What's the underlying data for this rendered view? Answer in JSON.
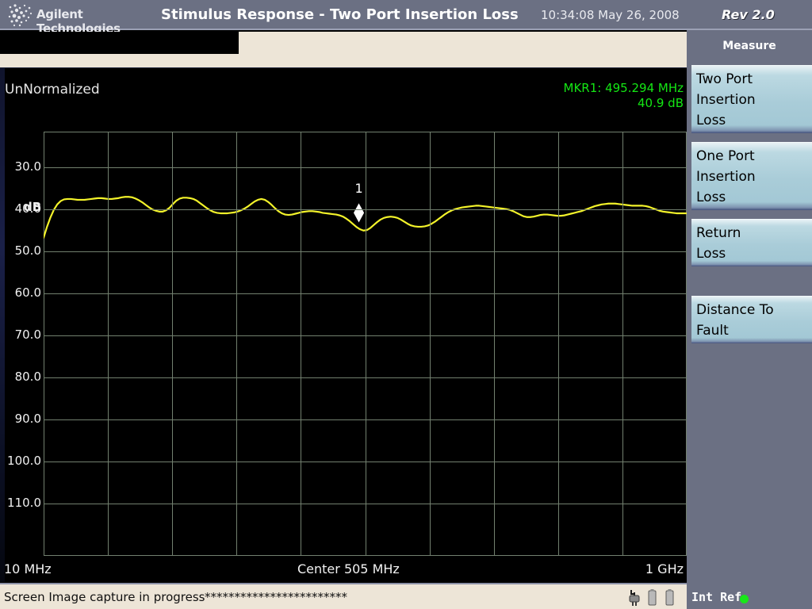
{
  "titlebar": {
    "brand": "Agilent Technologies",
    "brand_icon": "agilent-spark-logo",
    "title": "Stimulus Response - Two Port Insertion Loss",
    "clock": "10:34:08  May 26, 2008",
    "revision": "Rev 2.0"
  },
  "display": {
    "normalization_state": "UnNormalized",
    "marker_readout_line1": "MKR1: 495.294 MHz",
    "marker_readout_line2": "40.9 dB",
    "marker_color": "#14e614",
    "trace_color": "#f3f32a",
    "grid_color": "#72806f",
    "background_color": "#000000"
  },
  "softkeys": {
    "menu_title": "Measure",
    "items": [
      {
        "lines": [
          "Two Port",
          "Insertion",
          "Loss"
        ],
        "selected": true
      },
      {
        "lines": [
          "One Port",
          "Insertion",
          "Loss"
        ],
        "selected": false
      },
      {
        "lines": [
          "Return",
          "Loss"
        ],
        "selected": false
      },
      {
        "lines": [
          "Distance To",
          "Fault"
        ],
        "selected": false
      }
    ]
  },
  "statusbar": {
    "message": "Screen Image capture in progress",
    "progress_stars": "************************",
    "icons": [
      "power-plug-icon",
      "battery-icon",
      "battery-icon"
    ],
    "reference_label": "Int Ref",
    "reference_led_color": "#19e619"
  },
  "chart_data": {
    "type": "line",
    "title": "Two Port Insertion Loss",
    "xlabel": "",
    "ylabel": "dB",
    "x_start_label": "10 MHz",
    "x_center_label": "Center 505 MHz",
    "x_stop_label": "1 GHz",
    "xlim_mhz": [
      10,
      1000
    ],
    "x_divisions": 10,
    "ylim_db": [
      21.6,
      122.4
    ],
    "y_tick_labels": [
      "30.0",
      "40.0",
      "50.0",
      "60.0",
      "70.0",
      "80.0",
      "90.0",
      "100.0",
      "110.0"
    ],
    "y_ticks_db": [
      30,
      40,
      50,
      60,
      70,
      80,
      90,
      100,
      110
    ],
    "y_top_db": 21.6,
    "y_bottom_db": 122.4,
    "grid": true,
    "legend": "none",
    "markers": [
      {
        "id": "1",
        "label": "1",
        "frequency_mhz": 495.294,
        "value_db": 40.9
      }
    ],
    "series": [
      {
        "name": "Insertion Loss",
        "color": "#f3f32a",
        "points_db": [
          46.8,
          44.2,
          42.0,
          40.2,
          38.9,
          38.1,
          37.7,
          37.6,
          37.6,
          37.7,
          37.8,
          37.8,
          37.8,
          37.7,
          37.6,
          37.5,
          37.4,
          37.4,
          37.5,
          37.6,
          37.6,
          37.5,
          37.4,
          37.2,
          37.1,
          37.1,
          37.2,
          37.5,
          37.9,
          38.4,
          39.0,
          39.6,
          40.1,
          40.4,
          40.6,
          40.6,
          40.3,
          39.7,
          38.8,
          38.0,
          37.5,
          37.3,
          37.3,
          37.4,
          37.6,
          38.0,
          38.6,
          39.2,
          39.8,
          40.3,
          40.7,
          40.9,
          41.0,
          41.0,
          41.0,
          40.9,
          40.8,
          40.6,
          40.3,
          39.9,
          39.4,
          38.8,
          38.2,
          37.8,
          37.6,
          37.8,
          38.3,
          39.0,
          39.8,
          40.5,
          41.0,
          41.3,
          41.4,
          41.3,
          41.1,
          40.9,
          40.7,
          40.6,
          40.5,
          40.5,
          40.6,
          40.7,
          40.9,
          41.0,
          41.1,
          41.2,
          41.3,
          41.5,
          41.8,
          42.3,
          42.9,
          43.6,
          44.3,
          44.8,
          45.1,
          45.0,
          44.5,
          43.8,
          43.1,
          42.5,
          42.1,
          41.9,
          41.8,
          41.9,
          42.1,
          42.5,
          43.0,
          43.5,
          43.9,
          44.1,
          44.2,
          44.2,
          44.1,
          43.9,
          43.5,
          43.0,
          42.4,
          41.8,
          41.2,
          40.7,
          40.3,
          40.0,
          39.8,
          39.6,
          39.5,
          39.4,
          39.3,
          39.2,
          39.2,
          39.3,
          39.4,
          39.5,
          39.6,
          39.7,
          39.8,
          39.9,
          40.0,
          40.2,
          40.5,
          40.9,
          41.3,
          41.7,
          41.9,
          41.9,
          41.8,
          41.6,
          41.4,
          41.3,
          41.3,
          41.4,
          41.5,
          41.6,
          41.6,
          41.5,
          41.3,
          41.1,
          40.9,
          40.7,
          40.5,
          40.2,
          39.9,
          39.6,
          39.3,
          39.1,
          38.9,
          38.8,
          38.7,
          38.7,
          38.7,
          38.8,
          38.9,
          39.0,
          39.1,
          39.2,
          39.2,
          39.2,
          39.2,
          39.3,
          39.5,
          39.8,
          40.1,
          40.4,
          40.6,
          40.7,
          40.8,
          40.9,
          41.0,
          41.0,
          41.0,
          41.0
        ]
      }
    ]
  }
}
